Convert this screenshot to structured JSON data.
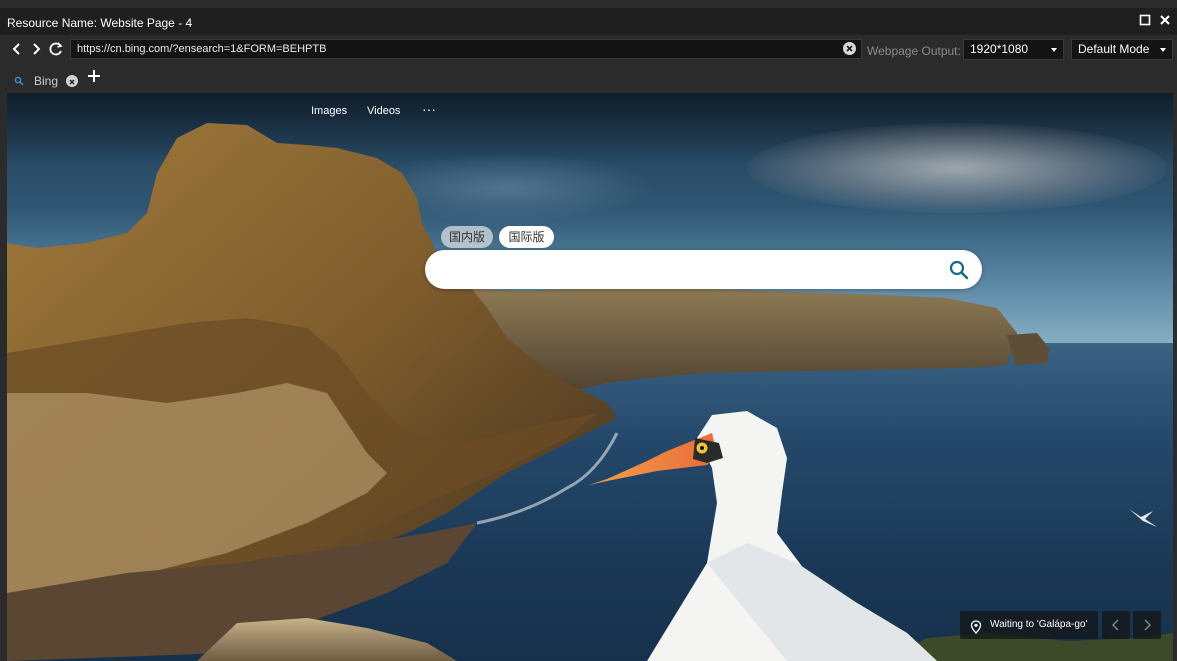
{
  "window": {
    "title": "Resource Name: Website Page - 4"
  },
  "toolbar": {
    "url": "https://cn.bing.com/?ensearch=1&FORM=BEHPTB",
    "output_label": "Webpage Output:",
    "resolution": "1920*1080",
    "mode": "Default Mode"
  },
  "tabs": [
    {
      "label": "Bing"
    }
  ],
  "bing": {
    "nav": {
      "images": "Images",
      "videos": "Videos",
      "more": "···"
    },
    "toggle": {
      "domestic": "国内版",
      "international": "国际版"
    },
    "search": {
      "placeholder": ""
    },
    "caption": "Waiting to 'Galápa-go'"
  },
  "colors": {
    "titlebar": "#1f1f1f",
    "chrome": "#2b2b2b",
    "search_accent": "#0e6e7e"
  }
}
